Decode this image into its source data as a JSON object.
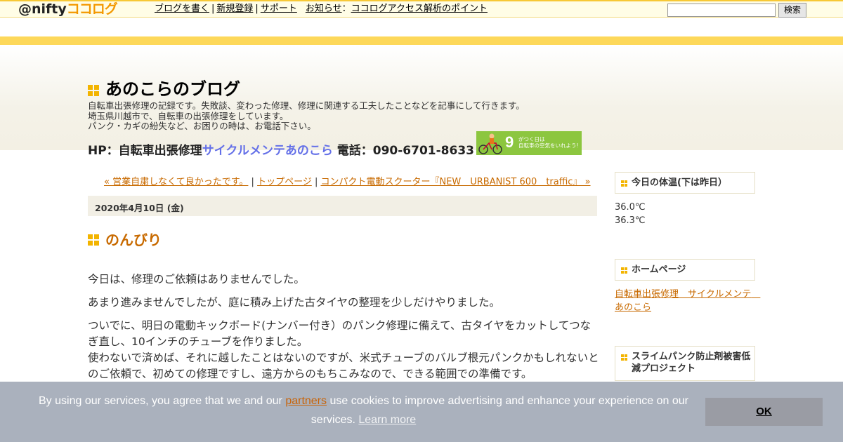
{
  "topbar": {
    "logo_at": "@nifty",
    "logo_coco": "ココログ",
    "nav": [
      "ブログを書く",
      "新規登録",
      "サポート"
    ],
    "news_label": "お知らせ",
    "news_colon": "：",
    "news_link": "ココログアクセス解析のポイント",
    "search_value": "",
    "search_button": "検索"
  },
  "header": {
    "title": "あのこらのブログ",
    "desc_lines": [
      "自転車出張修理の記録です。失敗談、変わった修理、修理に関連する工夫したことなどを記事にして行きます。",
      "埼玉県川越市で、自転車の出張修理をしています。",
      "パンク・カギの紛失など、お困りの時は、お電話下さい。"
    ],
    "hp_prefix": "HP：自転車出張修理",
    "hp_link": "サイクルメンテあのこら",
    "phone": " 電話：090-6701-8633",
    "banner_num": "9",
    "banner_text_1": "がつく日は",
    "banner_text_2": "自転車の空気をいれよう!"
  },
  "pager": {
    "prev": "« 営業自粛しなくて良かったです。",
    "sep": " | ",
    "top": "トップページ",
    "next": "コンパクト電動スクーター『NEW　URBANIST 600　traffic』 »"
  },
  "post": {
    "date": "2020年4月10日 (金)",
    "title": "のんびり",
    "p1": "今日は、修理のご依頼はありませんでした。",
    "p2": "あまり進みませんでしたが、庭に積み上げた古タイヤの整理を少しだけやりました。",
    "p3a": "ついでに、明日の電動キックボード(ナンバー付き）のパンク修理に備えて、古タイヤをカットしてつなぎ直し、10インチのチューブを作りました。",
    "p3b": "使わないで済めば、それに越したことはないのですが、米式チューブのバルブ根元パンクかもしれないとのご依頼で、初めての修理ですし、遠方からのもちこみなので、できる範囲での準備です。"
  },
  "sidebar": {
    "temp_title": "今日の体温(下は昨日）",
    "temp_today": "36.0℃",
    "temp_yesterday": "36.3℃",
    "home_title": "ホームページ",
    "home_link": "自転車出張修理　サイクルメンテ　あのこら",
    "slime_title": "スライムパンク防止剤被害低減プロジェクト"
  },
  "cookie": {
    "text_before": "By using our services, you agree that we and our ",
    "partners": "partners",
    "text_after": " use cookies to improve advertising and enhance your experience on our services. ",
    "learn_more": "Learn more",
    "ok": "OK"
  },
  "colors": {
    "accent_yellow": "#fdd85a",
    "link_orange": "#c86a00",
    "hp_link_blue": "#6470e8",
    "cookie_bg": "#aab1bd"
  }
}
